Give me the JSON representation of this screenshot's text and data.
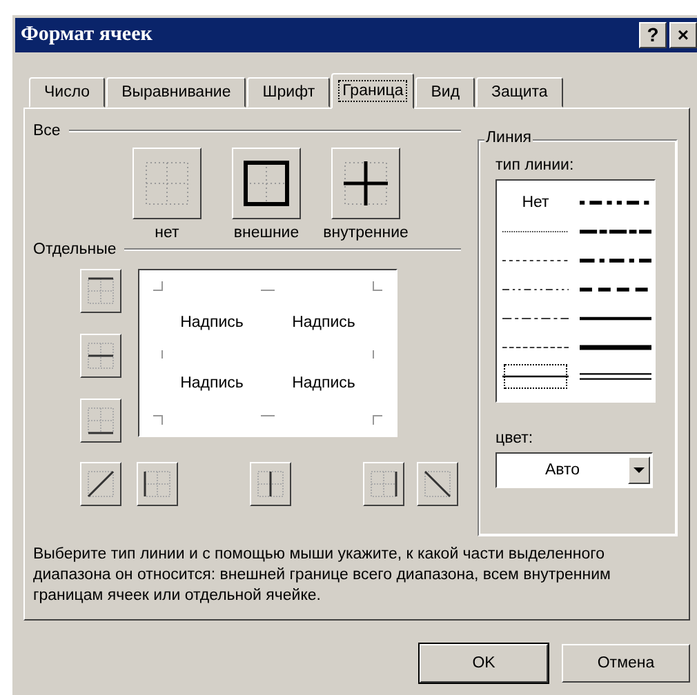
{
  "window": {
    "title": "Формат ячеек",
    "help_button": "?",
    "close_button": "×"
  },
  "tabs": [
    {
      "label": "Число",
      "selected": false
    },
    {
      "label": "Выравнивание",
      "selected": false
    },
    {
      "label": "Шрифт",
      "selected": false
    },
    {
      "label": "Граница",
      "selected": true
    },
    {
      "label": "Вид",
      "selected": false
    },
    {
      "label": "Защита",
      "selected": false
    }
  ],
  "presets": {
    "title": "Все",
    "items": [
      {
        "kind": "none",
        "label": "нет"
      },
      {
        "kind": "outline",
        "label": "внешние"
      },
      {
        "kind": "inside",
        "label": "внутренние"
      }
    ]
  },
  "individual": {
    "title": "Отдельные",
    "side_buttons": [
      {
        "kind": "top"
      },
      {
        "kind": "middle"
      },
      {
        "kind": "bottom"
      }
    ],
    "bottom_buttons": [
      {
        "kind": "diag-up"
      },
      {
        "kind": "left"
      },
      {
        "kind": "center"
      },
      {
        "kind": "right"
      },
      {
        "kind": "diag-down"
      }
    ],
    "preview_texts": [
      "Надпись",
      "Надпись",
      "Надпись",
      "Надпись"
    ]
  },
  "line": {
    "title": "Линия",
    "style_label": "тип линии:",
    "styles": [
      {
        "kind": "none",
        "label": "Нет",
        "selected": false
      },
      {
        "kind": "hair",
        "selected": false
      },
      {
        "kind": "dotted",
        "selected": false
      },
      {
        "kind": "dashdotdot",
        "selected": false
      },
      {
        "kind": "dashdot",
        "selected": false
      },
      {
        "kind": "dashed",
        "selected": false
      },
      {
        "kind": "thin",
        "selected": true
      },
      {
        "kind": "medium-dashdotdot",
        "selected": false
      },
      {
        "kind": "slant-dashdot",
        "selected": false
      },
      {
        "kind": "medium-dashdot",
        "selected": false
      },
      {
        "kind": "medium-dashed",
        "selected": false
      },
      {
        "kind": "medium",
        "selected": false
      },
      {
        "kind": "thick",
        "selected": false
      },
      {
        "kind": "double",
        "selected": false
      }
    ],
    "color_label": "цвет:",
    "color_value": "Авто"
  },
  "description": "Выберите тип линии и с помощью мыши укажите, к какой части выделенного диапазона он относится: внешней границе всего диапазона, всем внутренним границам ячеек или отдельной ячейке.",
  "buttons": [
    "OK",
    "Отмена"
  ]
}
